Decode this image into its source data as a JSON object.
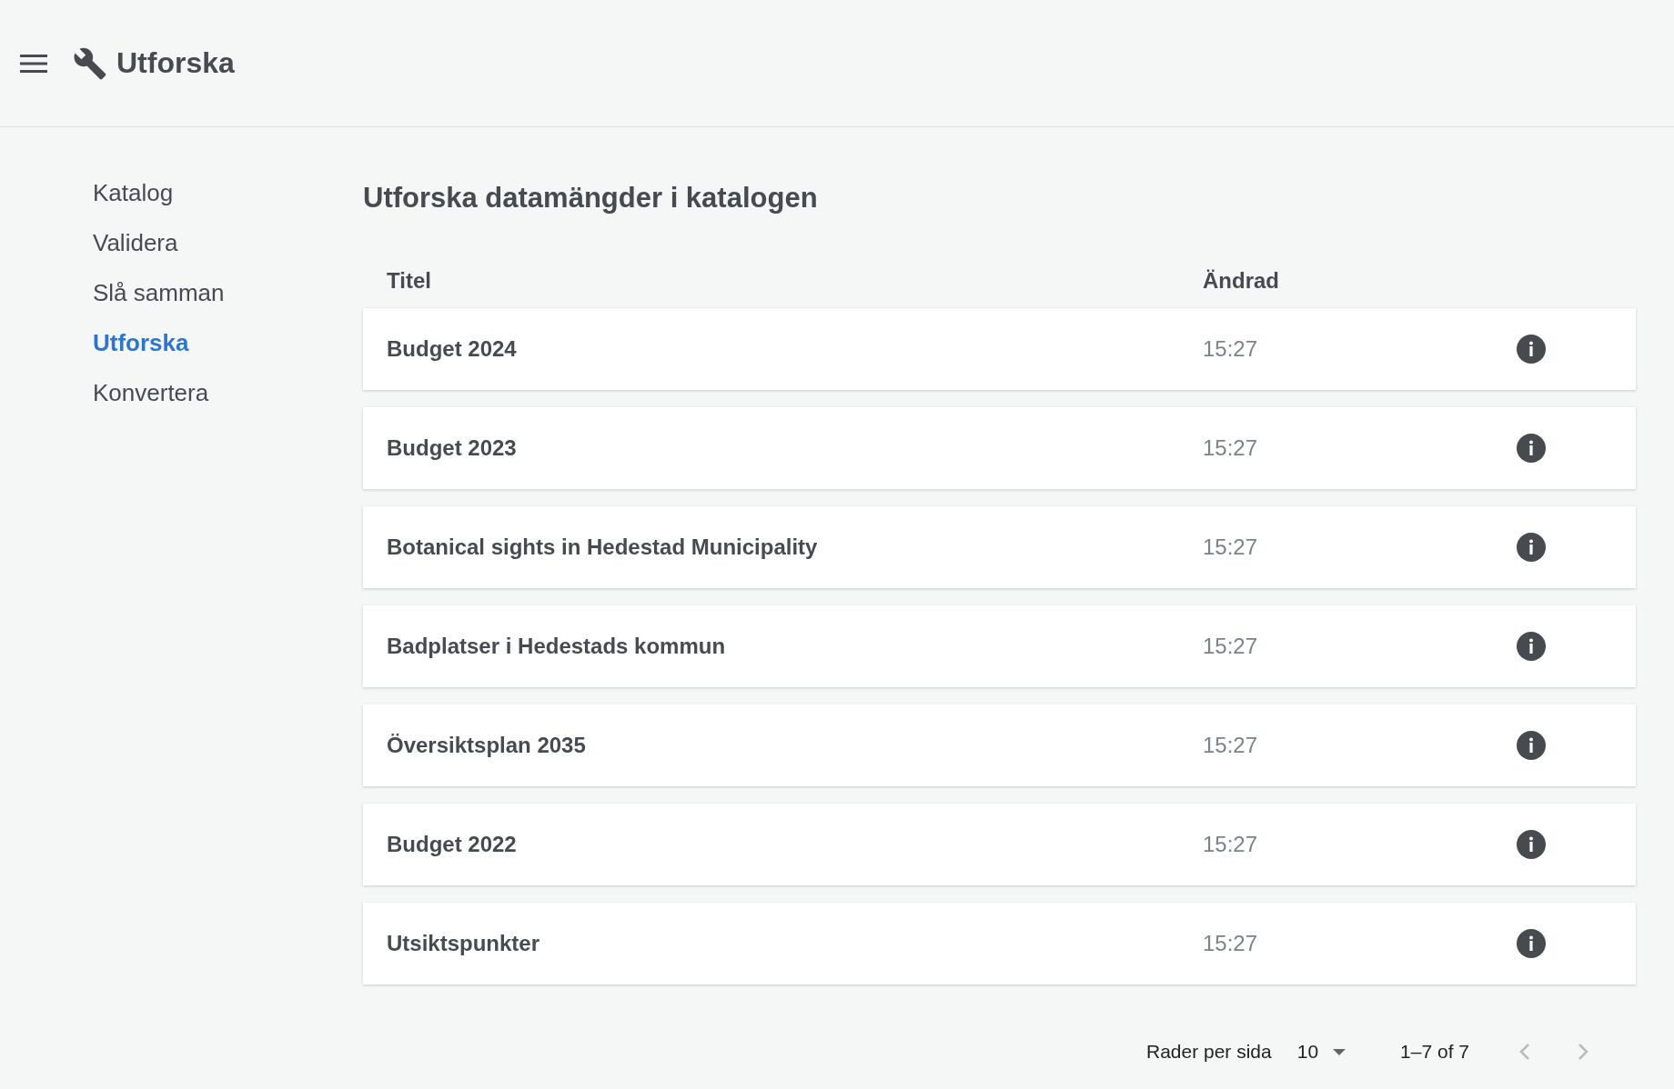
{
  "header": {
    "title": "Utforska"
  },
  "sidebar": {
    "items": [
      {
        "label": "Katalog",
        "selected": false
      },
      {
        "label": "Validera",
        "selected": false
      },
      {
        "label": "Slå samman",
        "selected": false
      },
      {
        "label": "Utforska",
        "selected": true
      },
      {
        "label": "Konvertera",
        "selected": false
      }
    ]
  },
  "main": {
    "heading": "Utforska datamängder i katalogen"
  },
  "table": {
    "columns": [
      "Titel",
      "Ändrad"
    ],
    "rows": [
      {
        "title": "Budget 2024",
        "modified": "15:27"
      },
      {
        "title": "Budget 2023",
        "modified": "15:27"
      },
      {
        "title": "Botanical sights in Hedestad Municipality",
        "modified": "15:27"
      },
      {
        "title": "Badplatser i Hedestads kommun",
        "modified": "15:27"
      },
      {
        "title": "Översiktsplan 2035",
        "modified": "15:27"
      },
      {
        "title": "Budget 2022",
        "modified": "15:27"
      },
      {
        "title": "Utsiktspunkter",
        "modified": "15:27"
      }
    ]
  },
  "pagination": {
    "rows_per_page_label": "Rader per sida",
    "rows_per_page": "10",
    "range": "1–7 of 7"
  }
}
